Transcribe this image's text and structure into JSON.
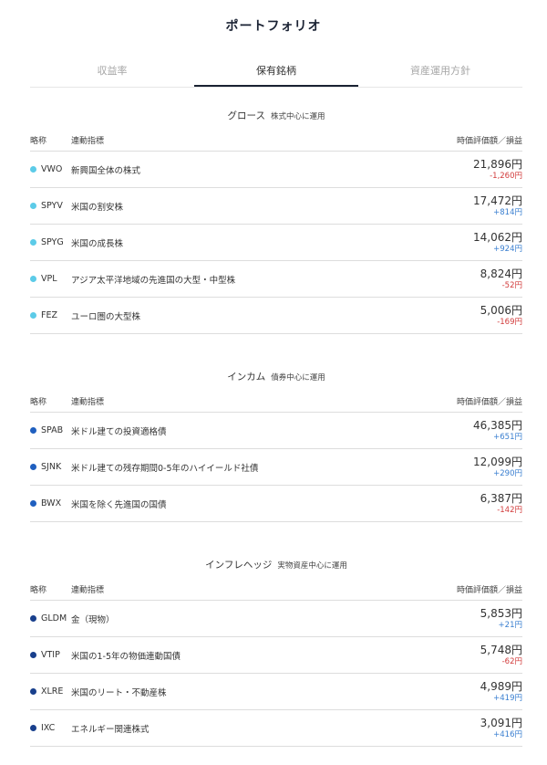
{
  "page_title": "ポートフォリオ",
  "tabs": [
    {
      "label": "収益率",
      "active": false
    },
    {
      "label": "保有銘柄",
      "active": true
    },
    {
      "label": "資産運用方針",
      "active": false
    }
  ],
  "colors": {
    "growth": "#5ccbe8",
    "income": "#1f5fbf",
    "inflation": "#183f8c",
    "positive": "#3a7fd0",
    "negative": "#d23c3c"
  },
  "sections": [
    {
      "title": "グロース",
      "subtitle": "株式中心に運用",
      "color_key": "growth",
      "headers": {
        "ticker": "略称",
        "index": "連動指標",
        "value": "時価評価額／損益"
      },
      "rows": [
        {
          "ticker": "VWO",
          "name": "新興国全体の株式",
          "value": "21,896円",
          "pl": "-1,260円",
          "sign": "neg"
        },
        {
          "ticker": "SPYV",
          "name": "米国の割安株",
          "value": "17,472円",
          "pl": "+814円",
          "sign": "pos"
        },
        {
          "ticker": "SPYG",
          "name": "米国の成長株",
          "value": "14,062円",
          "pl": "+924円",
          "sign": "pos"
        },
        {
          "ticker": "VPL",
          "name": "アジア太平洋地域の先進国の大型・中型株",
          "value": "8,824円",
          "pl": "-52円",
          "sign": "neg"
        },
        {
          "ticker": "FEZ",
          "name": "ユーロ圏の大型株",
          "value": "5,006円",
          "pl": "-169円",
          "sign": "neg"
        }
      ]
    },
    {
      "title": "インカム",
      "subtitle": "債券中心に運用",
      "color_key": "income",
      "headers": {
        "ticker": "略称",
        "index": "連動指標",
        "value": "時価評価額／損益"
      },
      "rows": [
        {
          "ticker": "SPAB",
          "name": "米ドル建ての投資適格債",
          "value": "46,385円",
          "pl": "+651円",
          "sign": "pos"
        },
        {
          "ticker": "SJNK",
          "name": "米ドル建ての残存期間0-5年のハイイールド社債",
          "value": "12,099円",
          "pl": "+290円",
          "sign": "pos"
        },
        {
          "ticker": "BWX",
          "name": "米国を除く先進国の国債",
          "value": "6,387円",
          "pl": "-142円",
          "sign": "neg"
        }
      ]
    },
    {
      "title": "インフレヘッジ",
      "subtitle": "実物資産中心に運用",
      "color_key": "inflation",
      "headers": {
        "ticker": "略称",
        "index": "連動指標",
        "value": "時価評価額／損益"
      },
      "rows": [
        {
          "ticker": "GLDM",
          "name": "金（現物）",
          "value": "5,853円",
          "pl": "+21円",
          "sign": "pos"
        },
        {
          "ticker": "VTIP",
          "name": "米国の1-5年の物価連動国債",
          "value": "5,748円",
          "pl": "-62円",
          "sign": "neg"
        },
        {
          "ticker": "XLRE",
          "name": "米国のリート・不動産株",
          "value": "4,989円",
          "pl": "+419円",
          "sign": "pos"
        },
        {
          "ticker": "IXC",
          "name": "エネルギー関連株式",
          "value": "3,091円",
          "pl": "+416円",
          "sign": "pos"
        }
      ]
    }
  ]
}
